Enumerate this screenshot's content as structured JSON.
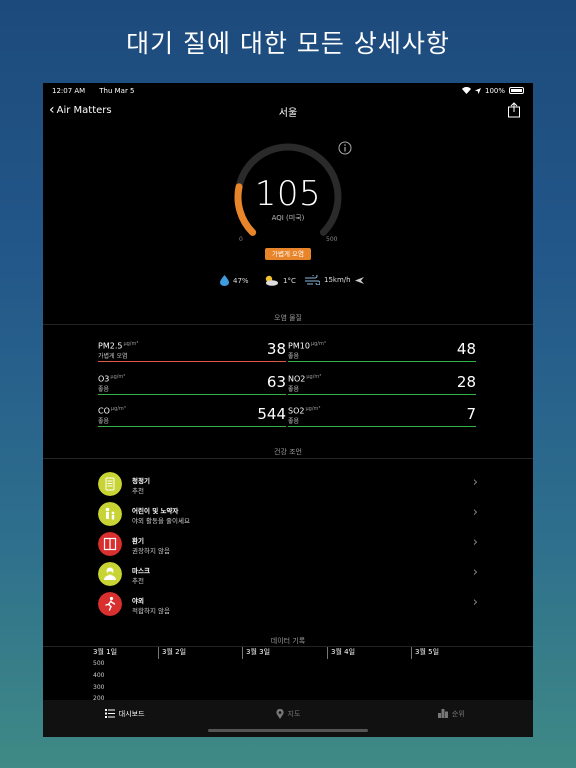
{
  "headline": "대기 질에 대한 모든 상세사항",
  "status_bar": {
    "time": "12:07 AM",
    "date": "Thu Mar 5",
    "battery": "100%"
  },
  "nav": {
    "back_label": "Air Matters",
    "city": "서울"
  },
  "aqi": {
    "value": "105",
    "unit": "AQI (미국)",
    "scale_min": "0",
    "scale_max": "500",
    "level": "가볍게 오염",
    "fraction": 0.21,
    "color": "#e8852a"
  },
  "weather": {
    "humidity": "47%",
    "temperature": "1°C",
    "wind": "15km/h"
  },
  "pollutants": {
    "title": "오염 물질",
    "unit": "μg/m³",
    "items": [
      {
        "name": "PM2.5",
        "status": "가볍게 오염",
        "value": "38",
        "color": "#e0584a"
      },
      {
        "name": "PM10",
        "status": "좋음",
        "value": "48",
        "color": "#35b34a"
      },
      {
        "name": "O3",
        "status": "좋음",
        "value": "63",
        "color": "#35b34a"
      },
      {
        "name": "NO2",
        "status": "좋음",
        "value": "28",
        "color": "#35b34a"
      },
      {
        "name": "CO",
        "status": "좋음",
        "value": "544",
        "color": "#35b34a"
      },
      {
        "name": "SO2",
        "status": "좋음",
        "value": "7",
        "color": "#35b34a"
      }
    ]
  },
  "health": {
    "title": "건강 조언",
    "items": [
      {
        "title": "청정기",
        "subtitle": "추천",
        "icon": "air-purifier-icon",
        "color": "#c8d434"
      },
      {
        "title": "어린이 및 노약자",
        "subtitle": "야외 활동을 줄이세요",
        "icon": "family-icon",
        "color": "#c8d434"
      },
      {
        "title": "환기",
        "subtitle": "권장하지 않음",
        "icon": "window-icon",
        "color": "#d8302e"
      },
      {
        "title": "마스크",
        "subtitle": "추천",
        "icon": "mask-icon",
        "color": "#c8d434"
      },
      {
        "title": "야외",
        "subtitle": "적합하지 않음",
        "icon": "running-icon",
        "color": "#d8302e"
      }
    ]
  },
  "history": {
    "title": "데이터 기록",
    "dates": [
      "3월 1일",
      "3월 2일",
      "3월 3일",
      "3월 4일",
      "3월 5일"
    ],
    "y_labels": [
      "500",
      "400",
      "300",
      "200"
    ]
  },
  "tabs": [
    {
      "label": "대시보드",
      "icon": "list-icon",
      "active": true
    },
    {
      "label": "지도",
      "icon": "map-pin-icon",
      "active": false
    },
    {
      "label": "순위",
      "icon": "ranking-icon",
      "active": false
    }
  ]
}
